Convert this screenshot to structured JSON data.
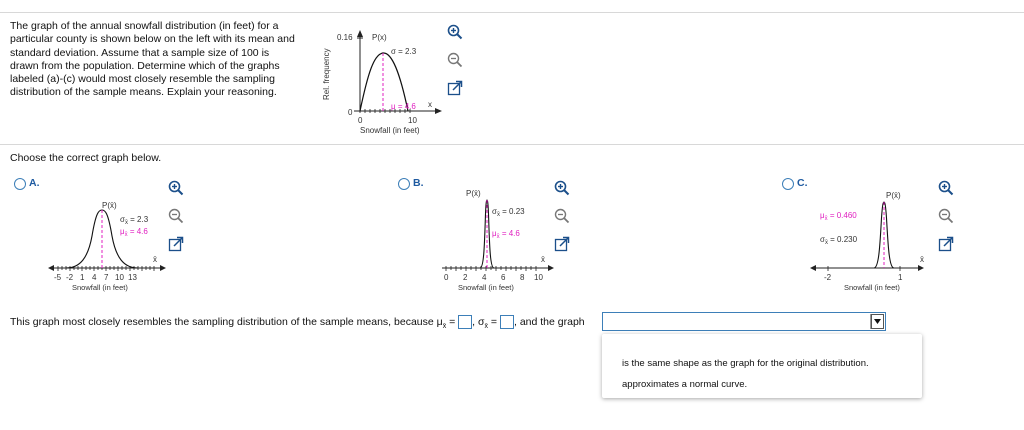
{
  "problem": {
    "lines": [
      "The graph of the annual snowfall distribution (in feet) for a",
      "particular county is shown below on the left with its mean and",
      "standard deviation. Assume that a sample size of 100 is",
      "drawn from the population. Determine which of the graphs",
      "labeled (a)-(c) would most closely resemble the sampling",
      "distribution of the sample means. Explain your reasoning."
    ]
  },
  "original_graph": {
    "y_label": "Rel. frequency",
    "y_tick": "0.16",
    "y_zero": "0",
    "func_label": "P(x)",
    "sigma_label": "σ = 2.3",
    "mu_label": "μ = 4.6",
    "x_axis_var": "x",
    "x_ticks": [
      "0",
      "10"
    ],
    "x_label": "Snowfall (in feet)"
  },
  "prompt": "Choose the correct graph below.",
  "options": [
    {
      "letter": "A.",
      "func_label": "P(x̄)",
      "sigma_label": "σ",
      "sigma_sub": "x̄",
      "sigma_value": " = 2.3",
      "mu_label": "μ",
      "mu_sub": "x̄",
      "mu_value": " = 4.6",
      "x_axis_var": "x̄",
      "x_ticks": [
        "-5",
        "-2",
        "1",
        "4",
        "7",
        "10",
        "13"
      ],
      "x_label": "Snowfall (in feet)"
    },
    {
      "letter": "B.",
      "func_label": "P(x̄)",
      "sigma_label": "σ",
      "sigma_sub": "x̄",
      "sigma_value": " = 0.23",
      "mu_label": "μ",
      "mu_sub": "x̄",
      "mu_value": " = 4.6",
      "x_axis_var": "x̄",
      "x_ticks": [
        "0",
        "2",
        "4",
        "6",
        "8",
        "10"
      ],
      "x_label": "Snowfall (in feet)"
    },
    {
      "letter": "C.",
      "func_label": "P(x̄)",
      "sigma_label": "σ",
      "sigma_sub": "x̄",
      "sigma_value": " = 0.230",
      "mu_label": "μ",
      "mu_sub": "x̄",
      "mu_value": " = 0.460",
      "x_axis_var": "x̄",
      "x_ticks": [
        "-2",
        "1"
      ],
      "x_label": "Snowfall (in feet)"
    }
  ],
  "answer": {
    "prefix": "This graph most closely resembles the sampling distribution of the sample means, because μ",
    "mu_sub": "x̄",
    "eq": " =",
    "sep": ", σ",
    "sigma_sub": "x̄",
    "eq2": " =",
    "suffix": ", and the graph",
    "select_value": ""
  },
  "dropdown": {
    "options": [
      "is the same shape as the graph for the original distribution.",
      "approximates a normal curve."
    ]
  },
  "colors": {
    "accent": "#1e5aa0",
    "mean_line": "#e020c0",
    "input_border": "#3d7fb8"
  },
  "icons": [
    "zoom-in-icon",
    "zoom-out-icon",
    "popout-icon"
  ]
}
